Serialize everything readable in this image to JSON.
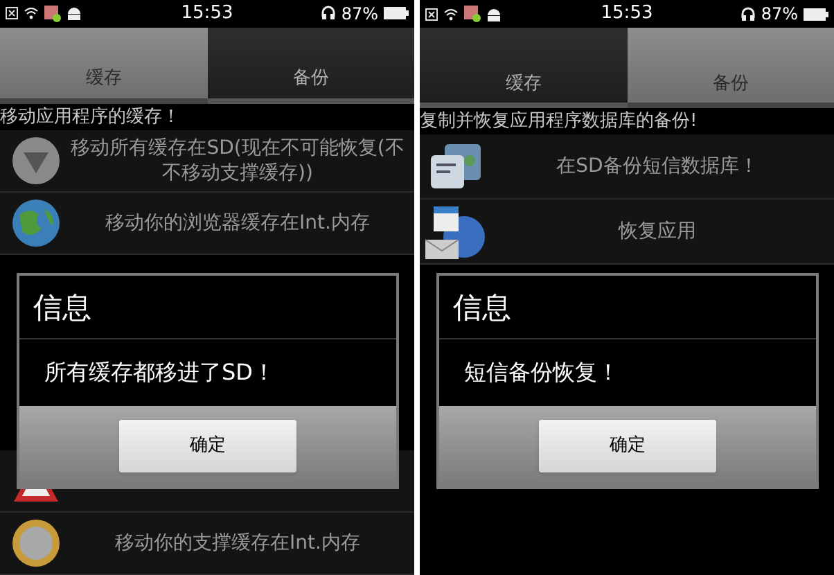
{
  "screens": [
    {
      "status_bar": {
        "time": "15:53",
        "battery": "87%"
      },
      "tabs": [
        {
          "label": "缓存",
          "selected": true
        },
        {
          "label": "备份",
          "selected": false
        }
      ],
      "subtitle": "移动应用程序的缓存！",
      "rows_top": [
        {
          "kind": "down",
          "label": "移动所有缓存在SD(现在不可能恢复(不不移动支撑缓存))"
        },
        {
          "kind": "globe",
          "label": "移动你的浏览器缓存在Int.内存"
        }
      ],
      "rows_bottom": [
        {
          "kind": "warning"
        },
        {
          "kind": "coin",
          "label": "移动你的支撑缓存在Int.内存"
        }
      ],
      "dialog": {
        "title": "信息",
        "message": "所有缓存都移进了SD！",
        "button": "确定"
      }
    },
    {
      "status_bar": {
        "time": "15:53",
        "battery": "87%"
      },
      "tabs": [
        {
          "label": "缓存",
          "selected": false
        },
        {
          "label": "备份",
          "selected": true
        }
      ],
      "subtitle": "复制并恢复应用程序数据库的备份!",
      "rows_top": [
        {
          "kind": "sms",
          "label": "在SD备份短信数据库！"
        },
        {
          "kind": "calendar",
          "label": "恢复应用"
        }
      ],
      "dialog": {
        "title": "信息",
        "message": "短信备份恢复！",
        "button": "确定"
      }
    }
  ]
}
